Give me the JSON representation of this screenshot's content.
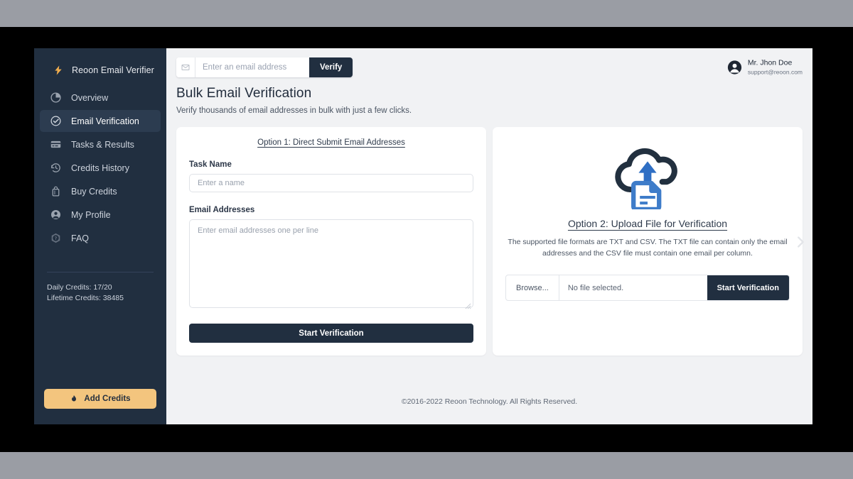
{
  "window": {
    "background_bar_color": "#9a9da4",
    "letterbox_color": "#000000"
  },
  "sidebar": {
    "brand": {
      "label": "Reoon Email Verifier",
      "icon": "bolt-icon",
      "icon_color": "#f0ad4e"
    },
    "items": [
      {
        "label": "Overview",
        "icon": "pie-chart-icon",
        "active": false
      },
      {
        "label": "Email Verification",
        "icon": "check-circle-icon",
        "active": true
      },
      {
        "label": "Tasks & Results",
        "icon": "credit-card-icon",
        "active": false
      },
      {
        "label": "Credits History",
        "icon": "history-clock-icon",
        "active": false
      },
      {
        "label": "Buy Credits",
        "icon": "shopping-bag-icon",
        "active": false
      },
      {
        "label": "My Profile",
        "icon": "user-circle-icon",
        "active": false
      },
      {
        "label": "FAQ",
        "icon": "question-badge-icon",
        "active": false
      }
    ],
    "credits": {
      "daily": "Daily Credits: 17/20",
      "lifetime": "Lifetime Credits: 38485"
    },
    "add_credits": {
      "label": "Add Credits",
      "icon": "flame-icon",
      "color": "#f3c57e"
    }
  },
  "topbar": {
    "search": {
      "icon": "envelope-icon",
      "placeholder": "Enter an email address",
      "value": "",
      "button_label": "Verify"
    },
    "user": {
      "avatar_icon": "user-avatar-icon",
      "name": "Mr. Jhon Doe",
      "email": "support@reoon.com"
    }
  },
  "page": {
    "title": "Bulk Email Verification",
    "subtitle": "Verify thousands of email addresses in bulk with just a few clicks."
  },
  "option1": {
    "title": "Option 1: Direct Submit Email Addresses",
    "task_name_label": "Task Name",
    "task_name_placeholder": "Enter a name",
    "task_name_value": "",
    "emails_label": "Email Addresses",
    "emails_placeholder": "Enter email addresses one per line",
    "emails_value": "",
    "submit_label": "Start Verification"
  },
  "option2": {
    "icon": "cloud-upload-file-icon",
    "title": "Option 2: Upload File for Verification",
    "description": "The supported file formats are TXT and CSV. The TXT file can contain only the email addresses and the CSV file must contain one email per column.",
    "browse_label": "Browse...",
    "file_status": "No file selected.",
    "submit_label": "Start Verification"
  },
  "carousel": {
    "next_icon": "chevron-right-icon"
  },
  "footer": {
    "text": "©2016-2022 Reoon Technology. All Rights Reserved."
  }
}
